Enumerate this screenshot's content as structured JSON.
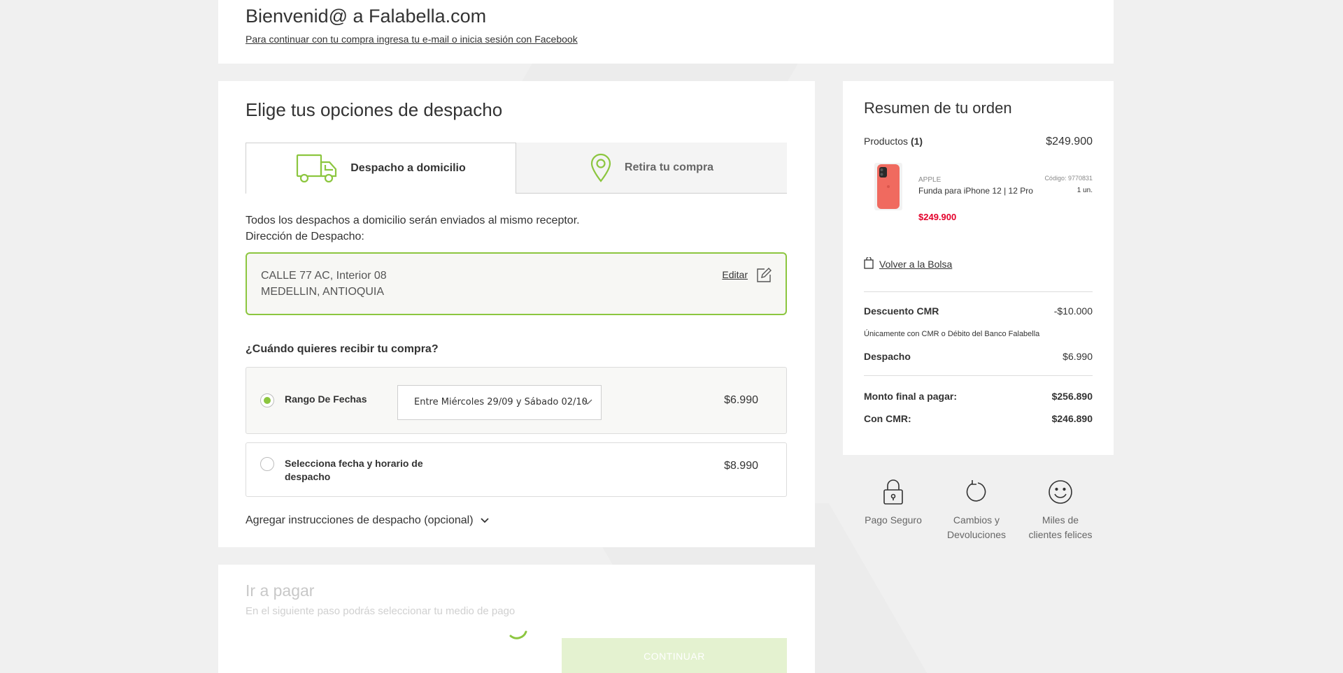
{
  "header": {
    "title": "Bienvenid@ a Falabella.com",
    "login_link": "Para continuar con tu compra ingresa tu e-mail o inicia sesión con Facebook"
  },
  "shipping": {
    "title": "Elige tus opciones de despacho",
    "tabs": [
      {
        "label": "Despacho a domicilio",
        "icon": "truck-icon",
        "active": true
      },
      {
        "label": "Retira tu compra",
        "icon": "location-pin-icon",
        "active": false
      }
    ],
    "info_line1": "Todos los despachos a domicilio serán enviados al mismo receptor.",
    "info_line2": "Dirección de Despacho:",
    "address": {
      "line1": "CALLE 77 AC, Interior 08",
      "line2": "MEDELLIN, ANTIOQUIA",
      "edit_label": "Editar"
    },
    "when_question": "¿Cuándo quieres recibir tu compra?",
    "options": [
      {
        "label": "Rango De Fechas",
        "selected": true,
        "dropdown_value": "Entre Miércoles 29/09 y Sábado 02/10",
        "price": "$6.990"
      },
      {
        "label": "Selecciona fecha y horario de despacho",
        "selected": false,
        "price": "$8.990"
      }
    ],
    "instructions_label": "Agregar instrucciones de despacho (opcional)"
  },
  "payment": {
    "title": "Ir a pagar",
    "subtitle": "En el siguiente paso podrás seleccionar tu medio de pago",
    "continue_label": "CONTINUAR"
  },
  "summary": {
    "title": "Resumen de tu orden",
    "products_label": "Productos",
    "products_count": "(1)",
    "products_total": "$249.900",
    "product": {
      "brand": "APPLE",
      "name": "Funda para iPhone 12 | 12 Pro",
      "code": "Código: 9770831",
      "quantity": "1 un.",
      "price": "$249.900"
    },
    "back_link": "Volver a la Bolsa",
    "cmr_discount_label": "Descuento CMR",
    "cmr_discount_value": "-$10.000",
    "cmr_note": "Únicamente con CMR o Débito del Banco Falabella",
    "shipping_label": "Despacho",
    "shipping_value": "$6.990",
    "final_label": "Monto final a pagar:",
    "final_value": "$256.890",
    "with_cmr_label": "Con CMR:",
    "with_cmr_value": "$246.890"
  },
  "badges": [
    {
      "icon": "padlock-icon",
      "line1": "Pago Seguro",
      "line2": ""
    },
    {
      "icon": "refresh-icon",
      "line1": "Cambios y",
      "line2": "Devoluciones"
    },
    {
      "icon": "smiley-icon",
      "line1": "Miles de",
      "line2": "clientes felices"
    }
  ],
  "colors": {
    "accent": "#8cc63f",
    "price_red": "#e4002b",
    "background": "#f0f0f0"
  }
}
